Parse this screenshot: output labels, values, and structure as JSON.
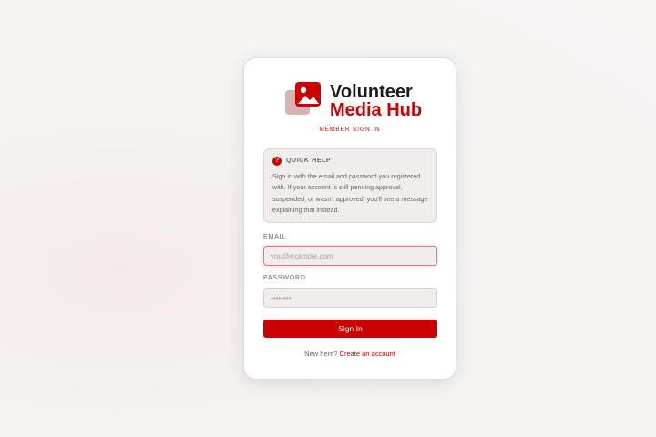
{
  "brand": {
    "line1": "Volunteer",
    "line2": "Media Hub",
    "subtitle": "MEMBER SIGN IN",
    "logo_icon": "image-gallery-icon"
  },
  "help": {
    "icon": "question-icon",
    "icon_glyph": "?",
    "title": "QUICK HELP",
    "body": "Sign in with the email and password you registered with. If your account is still pending approval, suspended, or wasn't approved, you'll see a message explaining that instead."
  },
  "form": {
    "email_label": "EMAIL",
    "email_placeholder": "you@example.com",
    "email_value": "",
    "password_label": "PASSWORD",
    "password_placeholder": "••••••••",
    "password_value": "",
    "submit_label": "Sign In"
  },
  "footer": {
    "prompt": "New here?",
    "link_label": "Create an account"
  },
  "colors": {
    "accent": "#cc0000",
    "text_dark": "#1c1c1c",
    "text_muted": "#6e6665",
    "panel_bg": "#f1edec"
  }
}
